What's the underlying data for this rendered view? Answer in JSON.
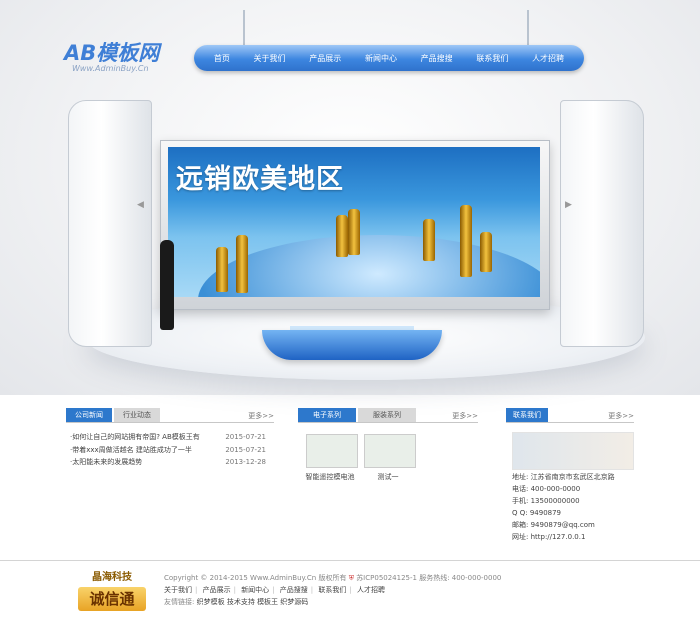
{
  "logo": {
    "main": "AB模板网",
    "sub": "Www.AdminBuy.Cn"
  },
  "nav": [
    "首页",
    "关于我们",
    "产品展示",
    "新闻中心",
    "产品搜搜",
    "联系我们",
    "人才招聘"
  ],
  "banner": {
    "title": "远销欧美地区"
  },
  "news_box": {
    "tabs": [
      "公司新闻",
      "行业动态"
    ],
    "more": "更多>>",
    "items": [
      {
        "title": "·如何让自己的网站拥有帝国? AB模板王有",
        "date": "2015-07-21"
      },
      {
        "title": "·带着xxx周做活越名 建站胜成功了一半",
        "date": "2015-07-21"
      },
      {
        "title": "·太阳能未来的发展趋势",
        "date": "2013-12-28"
      }
    ]
  },
  "product_box": {
    "tabs": [
      "电子系列",
      "服装系列"
    ],
    "more": "更多>>",
    "items": [
      {
        "name": "智能遥控模电池"
      },
      {
        "name": "测试一"
      }
    ]
  },
  "contact_box": {
    "tab": "联系我们",
    "more": "更多>>",
    "lines": [
      "地址: 江苏省南京市玄武区北京路",
      "电话: 400-000-0000",
      "手机: 13500000000",
      "Q  Q: 9490879",
      "邮箱: 9490879@qq.com",
      "网址: http://127.0.0.1"
    ]
  },
  "footer": {
    "logo_top": "晶海科技",
    "logo_bottom": "诚信通",
    "copyright": "Copyright © 2014-2015 Www.AdminBuy.Cn 版权所有",
    "icp": "苏ICP05024125-1 服务热线: 400-000-0000",
    "links": [
      "关于我们",
      "产品展示",
      "新闻中心",
      "产品搜搜",
      "联系我们",
      "人才招聘"
    ],
    "friend_label": "友情链接:",
    "friends": [
      "织梦模板",
      "技术支持",
      "模板王",
      "织梦源码"
    ]
  }
}
